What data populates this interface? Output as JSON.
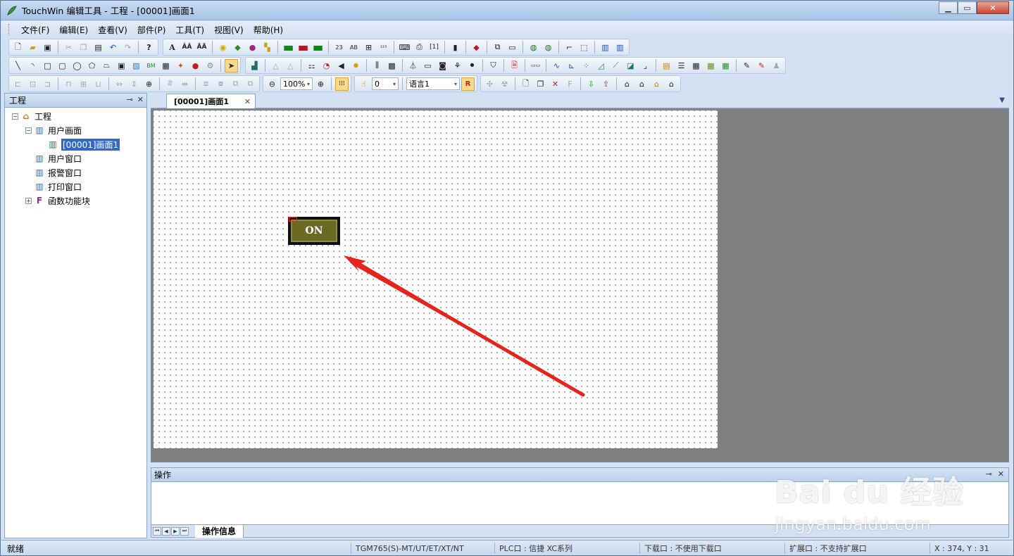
{
  "window": {
    "title": "TouchWin 编辑工具 - 工程 - [00001]画面1"
  },
  "menu": [
    "文件(F)",
    "编辑(E)",
    "查看(V)",
    "部件(P)",
    "工具(T)",
    "视图(V)",
    "帮助(H)"
  ],
  "toolbar": {
    "zoom": "100%",
    "state": "0",
    "language": "语言1"
  },
  "project_panel": {
    "title": "工程",
    "items": [
      {
        "label": "工程",
        "level": 0,
        "toggle": "−",
        "icon": "house-icon"
      },
      {
        "label": "用户画面",
        "level": 1,
        "toggle": "−",
        "icon": "screen-folder-icon"
      },
      {
        "label": "[00001]画面1",
        "level": 2,
        "toggle": "",
        "icon": "screen-icon",
        "selected": true
      },
      {
        "label": "用户窗口",
        "level": 1,
        "toggle": "",
        "icon": "window-folder-icon"
      },
      {
        "label": "报警窗口",
        "level": 1,
        "toggle": "",
        "icon": "alarm-folder-icon"
      },
      {
        "label": "打印窗口",
        "level": 1,
        "toggle": "",
        "icon": "print-folder-icon"
      },
      {
        "label": "函数功能块",
        "level": 1,
        "toggle": "+",
        "icon": "function-block-icon"
      }
    ]
  },
  "editor": {
    "tab_label": "[00001]画面1",
    "button_label": "ON"
  },
  "output_panel": {
    "title": "操作",
    "tab_label": "操作信息"
  },
  "statusbar": {
    "ready": "就绪",
    "model": "TGM765(S)-MT/UT/ET/XT/NT",
    "plc_port": "PLC口 : 信捷 XC系列",
    "download_port": "下载口 : 不使用下载口",
    "expansion_port": "扩展口 : 不支持扩展口",
    "coords": "X : 374, Y : 31"
  },
  "watermark": {
    "brand": "Bai du 经验",
    "url": "jingyan.baidu.com"
  },
  "colors": {
    "accent": "#3169c6",
    "arrow": "#e8231c",
    "canvas_bg": "#808080",
    "button_face": "#6c6a22"
  }
}
